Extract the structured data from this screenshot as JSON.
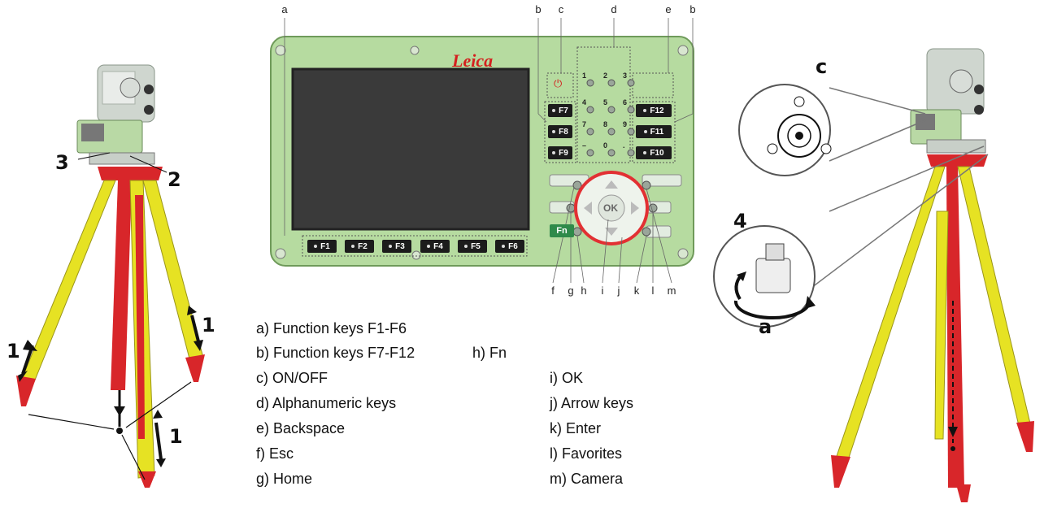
{
  "device": {
    "brand": "Leica",
    "function_keys_bottom": [
      "F1",
      "F2",
      "F3",
      "F4",
      "F5",
      "F6"
    ],
    "function_keys_left": [
      "F7",
      "F8",
      "F9"
    ],
    "function_keys_right": [
      "F12",
      "F11",
      "F10"
    ],
    "fn_key": "Fn",
    "ok_key": "OK",
    "callouts_top": [
      "a",
      "b",
      "c",
      "d",
      "e",
      "b"
    ],
    "callouts_bottom": [
      "f",
      "g",
      "h",
      "i",
      "j",
      "k",
      "l",
      "m"
    ]
  },
  "legend": {
    "a": "a) Function keys F1-F6",
    "b": "b) Function keys F7-F12",
    "c": "c) ON/OFF",
    "d": "d) Alphanumeric keys",
    "e": "e) Backspace",
    "f": "f) Esc",
    "g": "g) Home",
    "h": "h) Fn",
    "i": "i) OK",
    "j": "j) Arrow keys",
    "k": "k) Enter",
    "l": "l) Favorites",
    "m": "m) Camera"
  },
  "left_figure": {
    "labels": [
      "3",
      "2",
      "1",
      "1",
      "1"
    ]
  },
  "right_figure": {
    "labels": [
      "c",
      "4",
      "a"
    ]
  }
}
